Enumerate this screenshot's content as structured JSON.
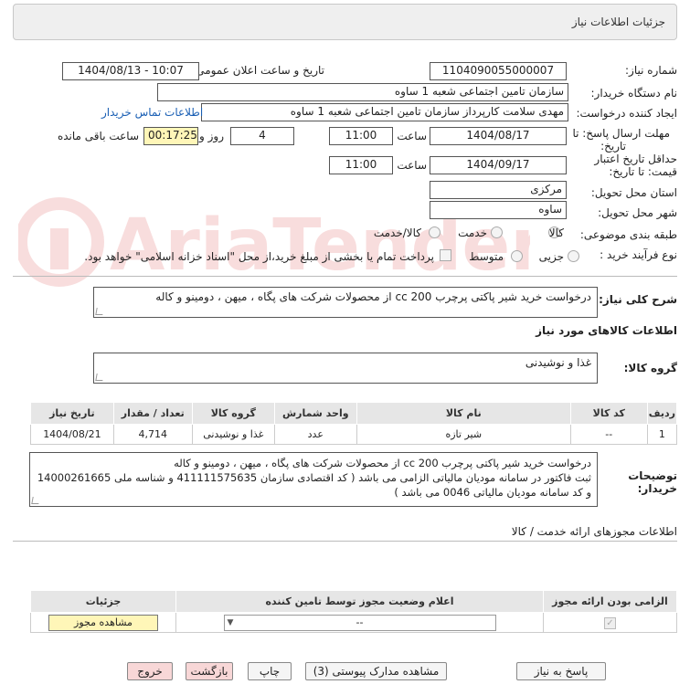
{
  "header": {
    "title": "جزئیات اطلاعات نیاز"
  },
  "form": {
    "need_number_label": "شماره نیاز:",
    "need_number": "1104090055000007",
    "announce_label": "تاریخ و ساعت اعلان عمومی:",
    "announce_value": "1404/08/13 - 10:07",
    "buyer_org_label": "نام دستگاه خریدار:",
    "buyer_org": "سازمان تامین اجتماعی شعبه 1 ساوه",
    "creator_label": "ایجاد کننده درخواست:",
    "creator": "مهدی سلامت کارپرداز سازمان تامین اجتماعی شعبه 1 ساوه",
    "contact_link": "اطلاعات تماس خریدار",
    "deadline_label_1": "مهلت ارسال پاسخ: تا",
    "deadline_label_2": "تاریخ:",
    "deadline_date": "1404/08/17",
    "time_label": "ساعت",
    "deadline_time": "11:00",
    "days_value": "4",
    "days_label": "روز و",
    "remaining_time": "00:17:25",
    "remaining_label": "ساعت باقی مانده",
    "validity_label_1": "حداقل تاریخ اعتبار",
    "validity_label_2": "قیمت: تا تاریخ:",
    "validity_date": "1404/09/17",
    "validity_time": "11:00",
    "province_label": "استان محل تحویل:",
    "province": "مرکزی",
    "city_label": "شهر محل تحویل:",
    "city": "ساوه",
    "category_label": "طبقه بندی موضوعی:",
    "category_options": [
      "کالا",
      "خدمت",
      "کالا/خدمت"
    ],
    "process_label": "نوع فرآیند خرید :",
    "process_options": [
      "جزیی",
      "متوسط"
    ],
    "payment_note": "پرداخت تمام یا بخشی از مبلغ خرید،از محل \"اسناد خزانه اسلامی\" خواهد بود."
  },
  "summary": {
    "label": "شرح کلی نیاز:",
    "text": "درخواست خرید شیر پاکتی پرچرب cc 200 از محصولات شرکت های پگاه ، میهن ، دومینو و کاله"
  },
  "goods": {
    "section_title": "اطلاعات کالاهای مورد نیاز",
    "group_label": "گروه کالا:",
    "group_value": "غذا و نوشیدنی",
    "columns": [
      "ردیف",
      "کد کالا",
      "نام کالا",
      "واحد شمارش",
      "گروه کالا",
      "تعداد / مقدار",
      "تاریخ نیاز"
    ],
    "rows": [
      [
        "1",
        "--",
        "شیر تازه",
        "عدد",
        "غذا و نوشیدنی",
        "4,714",
        "1404/08/21"
      ]
    ]
  },
  "buyer_notes": {
    "label_1": "توضیحات",
    "label_2": "خریدار:",
    "line1": "درخواست خرید شیر پاکتی پرچرب cc 200 از محصولات شرکت های پگاه ، میهن ، دومینو و کاله",
    "line2": "ثبت فاکتور در سامانه مودیان مالیاتی الزامی می باشد ( کد اقتصادی سازمان 411111575635 و شناسه ملی 14000261665",
    "line3": "و کد سامانه مودیان مالیاتی 0046 می باشد )"
  },
  "permits": {
    "title": "اطلاعات مجوزهای ارائه خدمت / کالا",
    "columns": [
      "الزامی بودن ارائه مجوز",
      "اعلام وضعیت مجوز توسط تامین کننده",
      "جزئیات"
    ],
    "select_value": "--",
    "view_button": "مشاهده مجوز"
  },
  "buttons": {
    "reply": "پاسخ به نیاز",
    "attachments": "مشاهده مدارک پیوستی (3)",
    "print": "چاپ",
    "back": "بازگشت",
    "exit": "خروج"
  },
  "colors": {
    "exit_bg": "#f8d7d7",
    "back_bg": "#f8d7d7",
    "link": "#1a5fb4",
    "remaining_bg": "#fff6b8"
  }
}
